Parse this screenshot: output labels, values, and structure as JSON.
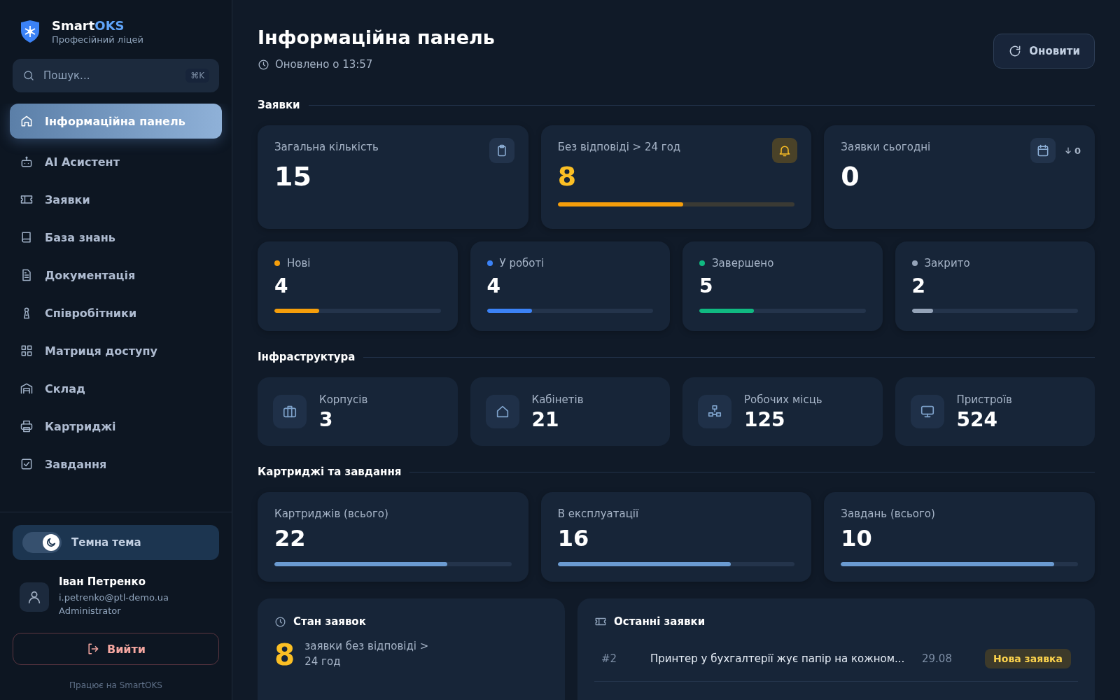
{
  "brand": {
    "name_main": "Smart",
    "name_accent": "OKS",
    "subtitle": "Професійний ліцей"
  },
  "search": {
    "placeholder": "Пошук...",
    "shortcut": "⌘K"
  },
  "nav": [
    {
      "label": "Інформаційна панель",
      "selected": true
    },
    {
      "label": "AI Асистент",
      "selected": false
    },
    {
      "label": "Заявки",
      "selected": false
    },
    {
      "label": "База знань",
      "selected": false
    },
    {
      "label": "Документація",
      "selected": false
    },
    {
      "label": "Співробітники",
      "selected": false
    },
    {
      "label": "Матриця доступу",
      "selected": false
    },
    {
      "label": "Склад",
      "selected": false
    },
    {
      "label": "Картриджі",
      "selected": false
    },
    {
      "label": "Завдання",
      "selected": false
    }
  ],
  "theme_toggle": {
    "label": "Темна тема",
    "on": true
  },
  "user": {
    "name": "Іван Петренко",
    "email": "i.petrenko@ptl-demo.ua",
    "role": "Administrator"
  },
  "logout": "Вийти",
  "footer": "Працює на SmartOKS",
  "header": {
    "title": "Інформаційна панель",
    "updated": "Оновлено о 13:57",
    "refresh": "Оновити"
  },
  "sections": [
    {
      "title": "Заявки"
    },
    {
      "title": "Інфраструктура"
    },
    {
      "title": "Картриджі та завдання"
    }
  ],
  "ticket_cards": [
    {
      "label": "Загальна кількість",
      "value": "15",
      "kind": "plain"
    },
    {
      "label": "Без відповіді > 24 год",
      "value": "8",
      "kind": "warning",
      "level": 0.53
    },
    {
      "label": "Заявки сьогодні",
      "value": "0",
      "kind": "trend",
      "trend": "0"
    }
  ],
  "status_cards": [
    {
      "label": "Нові",
      "value": "4",
      "color": "#f59e0b",
      "level": 0.27
    },
    {
      "label": "У роботі",
      "value": "4",
      "color": "#3b82f6",
      "level": 0.27
    },
    {
      "label": "Завершено",
      "value": "5",
      "color": "#10b981",
      "level": 0.33
    },
    {
      "label": "Закрито",
      "value": "2",
      "color": "#94a3b8",
      "level": 0.13
    }
  ],
  "infra_cards": [
    {
      "label": "Корпусів",
      "value": "3"
    },
    {
      "label": "Кабінетів",
      "value": "21"
    },
    {
      "label": "Робочих місць",
      "value": "125"
    },
    {
      "label": "Пристроїв",
      "value": "524"
    }
  ],
  "cartridge_cards": [
    {
      "label": "Картриджів (всього)",
      "value": "22",
      "level": 0.73
    },
    {
      "label": "В експлуатації",
      "value": "16",
      "level": 0.73
    },
    {
      "label": "Завдань (всього)",
      "value": "10",
      "level": 0.9
    }
  ],
  "status_panel": {
    "title": "Стан заявок",
    "value": "8",
    "text": "заявки без відповіді > 24 год"
  },
  "recent_panel": {
    "title": "Останні заявки",
    "rows": [
      {
        "id": "#2",
        "title": "Принтер у бухгалтерії жує папір на кожном...",
        "date": "29.08",
        "status": "Нова заявка"
      }
    ]
  }
}
